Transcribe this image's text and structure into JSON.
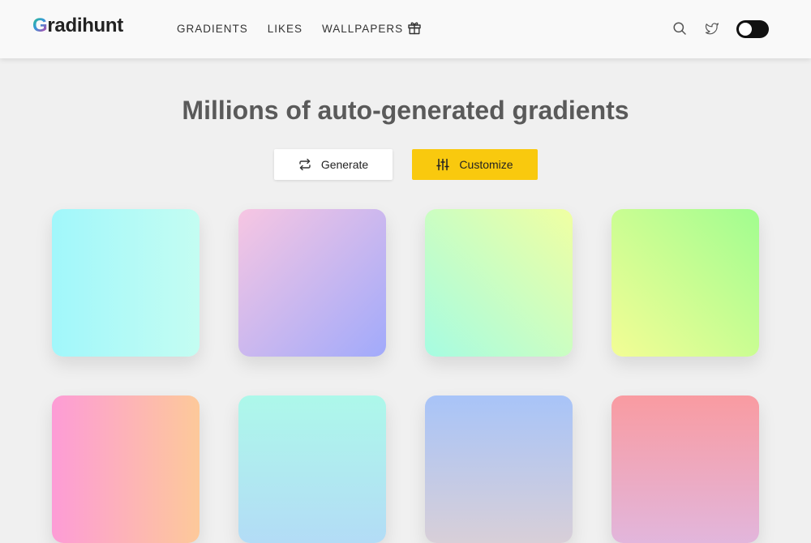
{
  "header": {
    "logo_initial": "G",
    "logo_rest": "radihunt",
    "nav": [
      {
        "label": "GRADIENTS"
      },
      {
        "label": "LIKES"
      },
      {
        "label": "WALLPAPERS"
      }
    ]
  },
  "hero": {
    "title": "Millions of auto-generated gradients",
    "generate_label": "Generate",
    "customize_label": "Customize"
  },
  "colors": {
    "accent": "#f9c90e",
    "title": "#5a5a5a",
    "toggle": "#111111"
  },
  "gradients": [
    {
      "from": "#a1f7fb",
      "to": "#c4fdf2",
      "dir": "to right"
    },
    {
      "from": "#f7c6e2",
      "to": "#a1aafb",
      "dir": "to bottom right"
    },
    {
      "from": "#f0ffa2",
      "to": "#a6fce2",
      "dir": "to bottom left"
    },
    {
      "from": "#a1fd90",
      "to": "#f3fd95",
      "dir": "to bottom left"
    },
    {
      "from": "#fd9cd6",
      "to": "#fdc99a",
      "dir": "to right"
    },
    {
      "from": "#adf8ea",
      "to": "#b3dcf6",
      "dir": "to bottom"
    },
    {
      "from": "#a8c4f8",
      "to": "#d8cfd8",
      "dir": "to bottom"
    },
    {
      "from": "#f99ba1",
      "to": "#e2b6dc",
      "dir": "to bottom"
    }
  ]
}
